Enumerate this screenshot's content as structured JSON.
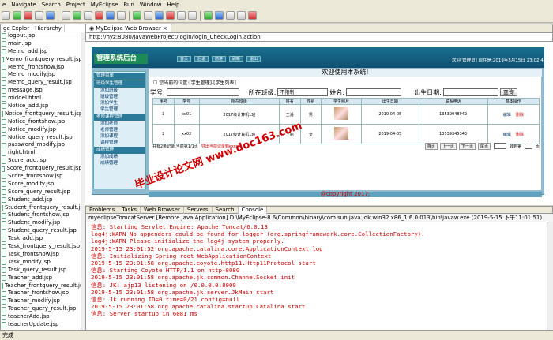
{
  "menu": [
    "e",
    "Navigate",
    "Search",
    "Project",
    "MyEclipse",
    "Run",
    "Window",
    "Help"
  ],
  "left_panel": {
    "tabs": [
      "ge Explor",
      "Hierarchy"
    ],
    "files": [
      "logout.jsp",
      "main.jsp",
      "Memo_add.jsp",
      "Memo_frontquery_result.jsp",
      "Memo_frontshow.jsp",
      "Memo_modify.jsp",
      "Memo_query_result.jsp",
      "message.jsp",
      "middel.html",
      "Notice_add.jsp",
      "Notice_frontquery_result.jsp",
      "Notice_frontshow.jsp",
      "Notice_modify.jsp",
      "Notice_query_result.jsp",
      "password_modify.jsp",
      "right.html",
      "Score_add.jsp",
      "Score_frontquery_result.jsp",
      "Score_frontshow.jsp",
      "Score_modify.jsp",
      "Score_query_result.jsp",
      "Student_add.jsp",
      "Student_frontquery_result.jsp",
      "Student_frontshow.jsp",
      "Student_modify.jsp",
      "Student_query_result.jsp",
      "Task_add.jsp",
      "Task_frontquery_result.jsp",
      "Task_frontshow.jsp",
      "Task_modify.jsp",
      "Task_query_result.jsp",
      "Teacher_add.jsp",
      "Teacher_frontquery_result.jsp",
      "Teacher_frontshow.jsp",
      "Teacher_modify.jsp",
      "Teacher_query_result.jsp",
      "teacherAdd.jsp",
      "teacherUpdate.jsp"
    ]
  },
  "browser": {
    "tab": "MyEclipse Web Browser",
    "url": "http://hyz:8080/JavaWebProject/login/login_CheckLogin.action"
  },
  "webapp": {
    "logo": "管理系统后台",
    "nav": [
      "首页",
      "后退",
      "前进",
      "刷新",
      "退出"
    ],
    "welcome": "欢迎[管理员] 现在是:2019年5月15日 23:02:46",
    "banner": "欢迎使用本系统!",
    "location": "您当前的位置:[学生管理]-[学生列表]",
    "menu_groups": [
      {
        "title": "管理菜单",
        "items": []
      },
      {
        "title": "班级学生管理",
        "items": [
          "添加班级",
          "班级管理",
          "添加学生",
          "学生管理"
        ]
      },
      {
        "title": "老师课程管理",
        "items": [
          "添加老师",
          "老师管理",
          "添加课程",
          "课程管理"
        ]
      },
      {
        "title": "成绩管理",
        "items": [
          "添加成绩",
          "成绩管理"
        ]
      }
    ],
    "search": {
      "label_no": "学号:",
      "label_class": "所在班级:",
      "class_value": "不限制",
      "label_name": "姓名:",
      "label_birth": "出生日期:",
      "button": "查询"
    },
    "table_headers": [
      "序号",
      "学号",
      "所在班级",
      "姓名",
      "性别",
      "学生照片",
      "出生日期",
      "联系电话",
      "基本操作"
    ],
    "rows": [
      {
        "idx": "1",
        "no": "xx01",
        "cls": "2017级计算机1班",
        "name": "王潘",
        "sex": "男",
        "birth": "2019-04-05",
        "phone": "13539948942",
        "ops": [
          "编辑",
          "删除"
        ]
      },
      {
        "idx": "2",
        "no": "xx02",
        "cls": "2017级计算机1班",
        "name": "王丽",
        "sex": "女",
        "birth": "2019-04-05",
        "phone": "13539345343",
        "ops": [
          "编辑",
          "删除"
        ]
      }
    ],
    "pager": {
      "info": "共有2条记录,当前第1/1页",
      "export": "导出当前记录到excel",
      "buttons": [
        "首页",
        "上一页",
        "下一页",
        "尾页"
      ],
      "goto": "转到第",
      "go": "页"
    },
    "footer": "@copyright 2017;"
  },
  "watermark": "毕业设计论文网 www.doc163.com",
  "bottom_tabs": [
    "Problems",
    "Tasks",
    "Web Browser",
    "Servers",
    "Search",
    "Console"
  ],
  "console": {
    "header": "myeclipseTomcatServer [Remote Java Application] D:\\MyEclipse-8.6\\Common\\binary\\com.sun.java.jdk.win32.x86_1.6.0.013\\bin\\javaw.exe (2019-5-15 下午11:01:51)",
    "lines": [
      {
        "t": "信息: Starting Servlet Engine: Apache Tomcat/6.0.13",
        "red": true
      },
      {
        "t": "log4j:WARN No appenders could be found for logger (org.springframework.core.CollectionFactory).",
        "red": true
      },
      {
        "t": "log4j:WARN Please initialize the log4j system properly.",
        "red": true
      },
      {
        "t": "2019-5-15 23:01:52 org.apache.catalina.core.ApplicationContext log",
        "red": true
      },
      {
        "t": "信息: Initializing Spring root WebApplicationContext",
        "red": true
      },
      {
        "t": "2019-5-15 23:01:58 org.apache.coyote.http11.Http11Protocol start",
        "red": true
      },
      {
        "t": "信息: Starting Coyote HTTP/1.1 on http-8080",
        "red": true
      },
      {
        "t": "2019-5-15 23:01:58 org.apache.jk.common.ChannelSocket init",
        "red": true
      },
      {
        "t": "信息: JK: ajp13 listening on /0.0.0.0:8009",
        "red": true
      },
      {
        "t": "2019-5-15 23:01:58 org.apache.jk.server.JkMain start",
        "red": true
      },
      {
        "t": "信息: Jk running ID=0 time=0/21  config=null",
        "red": true
      },
      {
        "t": "2019-5-15 23:01:58 org.apache.catalina.startup.Catalina start",
        "red": true
      },
      {
        "t": "信息: Server startup in 6081 ms",
        "red": true
      }
    ]
  },
  "status": "完成"
}
